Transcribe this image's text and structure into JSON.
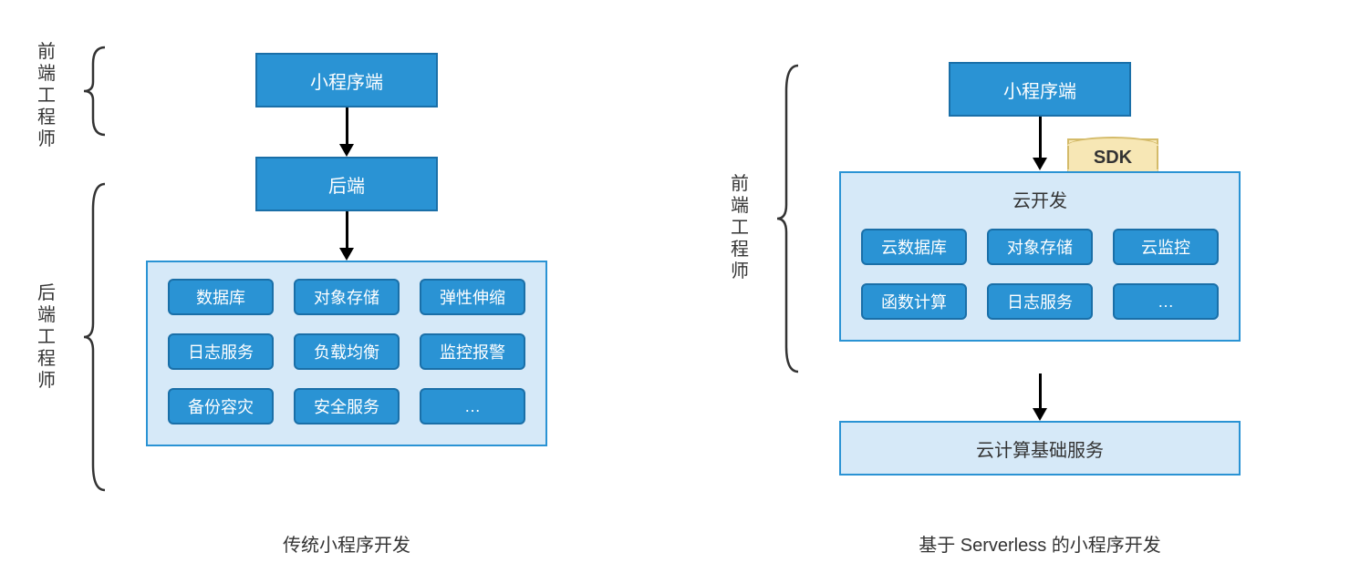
{
  "left": {
    "role1": "前端工程师",
    "role2": "后端工程师",
    "box1": "小程序端",
    "box2": "后端",
    "services": [
      "数据库",
      "对象存储",
      "弹性伸缩",
      "日志服务",
      "负载均衡",
      "监控报警",
      "备份容灾",
      "安全服务",
      "…"
    ],
    "caption": "传统小程序开发"
  },
  "right": {
    "role1": "前端工程师",
    "box1": "小程序端",
    "sdk": "SDK",
    "cloud_title": "云开发",
    "cloud_services": [
      "云数据库",
      "对象存储",
      "云监控",
      "函数计算",
      "日志服务",
      "…"
    ],
    "box_bottom": "云计算基础服务",
    "caption": "基于 Serverless 的小程序开发"
  }
}
